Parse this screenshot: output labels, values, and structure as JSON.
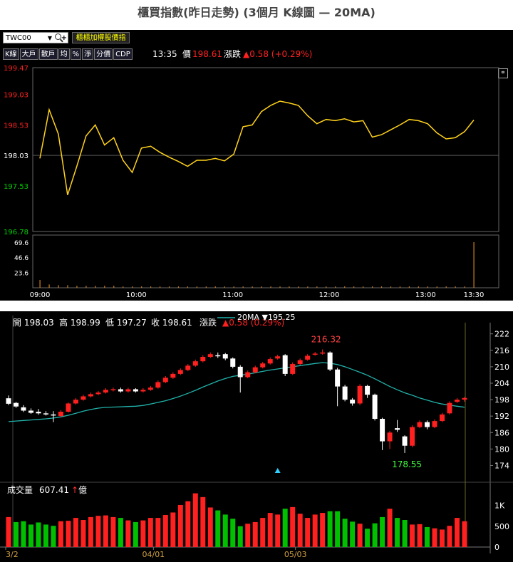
{
  "title": "櫃買指數(昨日走勢) (3個月 K線圖  — 20MA)",
  "toolbar": {
    "symbol": "TWC00",
    "otc_button": "櫃櫃加權股價指",
    "tools": [
      "K線",
      "大戶",
      "散戶",
      "均",
      "%",
      "淨",
      "分價",
      "CDP"
    ]
  },
  "quote": {
    "time": "13:35",
    "price_label": "價",
    "price": "198.61",
    "change_label": "漲跌",
    "change": "▲0.58 (+0.29%)"
  },
  "icons": {
    "link": "link-icon",
    "search": "search-icon",
    "add": "plus-icon"
  },
  "colors": {
    "up": "#ff2020",
    "down": "#00c000",
    "flat": "#ffffff",
    "line": "#ffd21a",
    "ma": "#20b2aa"
  },
  "chart_data": [
    {
      "type": "line",
      "yticks": [
        "199.47",
        "199.03",
        "198.53",
        "198.03",
        "197.53",
        "196.78"
      ],
      "ylim": [
        196.78,
        199.47
      ],
      "volume_ticks": [
        "69.6",
        "46.6",
        "23.6"
      ],
      "xticks": [
        "09:00",
        "10:00",
        "11:00",
        "12:00",
        "13:00",
        "13:30"
      ],
      "x": [
        "09:00",
        "09:05",
        "09:10",
        "09:15",
        "09:20",
        "09:25",
        "09:30",
        "09:35",
        "09:40",
        "09:45",
        "09:50",
        "09:55",
        "10:00",
        "10:05",
        "10:10",
        "10:15",
        "10:20",
        "10:25",
        "10:30",
        "10:35",
        "10:40",
        "10:45",
        "10:50",
        "10:55",
        "11:00",
        "11:05",
        "11:10",
        "11:15",
        "11:20",
        "11:25",
        "11:30",
        "11:35",
        "11:40",
        "11:45",
        "11:50",
        "11:55",
        "12:00",
        "12:05",
        "12:10",
        "12:15",
        "12:20",
        "12:25",
        "12:30",
        "12:35",
        "12:40",
        "12:45",
        "12:50",
        "12:55",
        "13:00",
        "13:05",
        "13:10",
        "13:15",
        "13:20",
        "13:25",
        "13:30"
      ],
      "values": [
        197.98,
        198.78,
        198.38,
        197.38,
        197.85,
        198.35,
        198.53,
        198.2,
        198.32,
        197.95,
        197.75,
        198.15,
        198.18,
        198.08,
        198.0,
        197.93,
        197.85,
        197.95,
        197.95,
        197.98,
        197.94,
        198.05,
        198.5,
        198.53,
        198.75,
        198.85,
        198.92,
        198.89,
        198.85,
        198.68,
        198.55,
        198.62,
        198.6,
        198.63,
        198.58,
        198.6,
        198.33,
        198.37,
        198.45,
        198.53,
        198.62,
        198.6,
        198.55,
        198.4,
        198.3,
        198.32,
        198.42,
        198.61
      ],
      "volume": [
        12,
        5,
        4,
        4,
        3,
        3,
        3,
        3,
        3,
        2,
        2,
        2,
        2,
        2,
        2,
        2,
        2,
        2,
        2,
        2,
        2,
        2,
        2,
        2,
        2,
        2,
        2,
        2,
        2,
        2,
        2,
        2,
        2,
        2,
        2,
        2,
        2,
        2,
        2,
        2,
        2,
        2,
        2,
        2,
        2,
        2,
        2,
        69.6
      ]
    },
    {
      "type": "candlestick",
      "ohlc_label": {
        "open": "開 198.03",
        "high": "高 198.99",
        "low": "低 197.27",
        "close": "收 198.61",
        "change_label": "漲跌",
        "change": "▲0.58 (0.29%)"
      },
      "ma_label": "20MA ▼195.25",
      "yticks": [
        "222",
        "216",
        "210",
        "204",
        "198",
        "192",
        "186",
        "180",
        "174"
      ],
      "ylim": [
        171,
        224
      ],
      "volume_label": {
        "text": "成交量",
        "value": "607.41",
        "unit": "億"
      },
      "volume_ticks": [
        "1K",
        "500",
        "0"
      ],
      "vlim": [
        0,
        1300
      ],
      "xticks": [
        "3/2",
        "04/01",
        "05/03"
      ],
      "annotations": [
        "216.32",
        "178.55"
      ],
      "candles": [
        [
          198.5,
          196.5,
          199.5,
          196.0
        ],
        [
          196.8,
          195.5,
          197.2,
          195.0
        ],
        [
          195.2,
          194.0,
          196.0,
          193.5
        ],
        [
          194.0,
          193.2,
          194.8,
          192.8
        ],
        [
          193.6,
          193.0,
          194.6,
          192.5
        ],
        [
          193.0,
          192.6,
          193.8,
          192.2
        ],
        [
          192.6,
          192.2,
          193.8,
          189.8
        ],
        [
          192.0,
          193.6,
          194.2,
          191.6
        ],
        [
          193.6,
          196.6,
          197.0,
          193.3
        ],
        [
          196.6,
          198.0,
          198.6,
          196.2
        ],
        [
          198.0,
          199.2,
          199.8,
          197.6
        ],
        [
          199.2,
          200.0,
          200.6,
          198.8
        ],
        [
          200.0,
          200.6,
          201.2,
          199.6
        ],
        [
          200.6,
          201.6,
          202.2,
          200.2
        ],
        [
          201.6,
          201.8,
          202.4,
          201.0
        ],
        [
          201.8,
          201.0,
          202.4,
          200.6
        ],
        [
          201.0,
          201.8,
          202.4,
          200.6
        ],
        [
          201.8,
          201.0,
          202.2,
          200.6
        ],
        [
          201.0,
          201.6,
          202.2,
          200.6
        ],
        [
          201.6,
          202.4,
          203.0,
          201.2
        ],
        [
          202.4,
          204.4,
          205.0,
          202.0
        ],
        [
          204.4,
          206.0,
          206.6,
          204.0
        ],
        [
          206.0,
          207.4,
          208.0,
          205.6
        ],
        [
          207.4,
          208.8,
          209.4,
          207.0
        ],
        [
          208.8,
          210.4,
          211.0,
          208.4
        ],
        [
          210.4,
          212.0,
          212.6,
          210.0
        ],
        [
          212.0,
          213.6,
          214.2,
          211.6
        ],
        [
          213.6,
          214.6,
          215.2,
          213.2
        ],
        [
          214.2,
          214.2,
          215.2,
          213.2
        ],
        [
          214.6,
          213.0,
          215.0,
          212.4
        ],
        [
          213.0,
          210.0,
          213.4,
          209.4
        ],
        [
          210.0,
          206.2,
          210.6,
          200.6
        ],
        [
          206.2,
          208.0,
          208.6,
          205.8
        ],
        [
          208.0,
          209.8,
          210.4,
          207.6
        ],
        [
          209.8,
          211.2,
          211.8,
          209.4
        ],
        [
          211.2,
          212.8,
          213.4,
          210.8
        ],
        [
          213.0,
          213.8,
          214.4,
          212.6
        ],
        [
          214.2,
          207.4,
          214.6,
          206.6
        ],
        [
          207.4,
          211.0,
          211.6,
          207.0
        ],
        [
          211.0,
          212.4,
          213.0,
          210.6
        ],
        [
          212.6,
          214.0,
          214.6,
          212.2
        ],
        [
          214.4,
          214.8,
          215.4,
          214.0
        ],
        [
          214.8,
          215.2,
          216.32,
          214.4
        ],
        [
          215.2,
          209.0,
          215.6,
          208.4
        ],
        [
          209.0,
          202.8,
          209.6,
          195.6
        ],
        [
          202.8,
          198.0,
          203.4,
          197.4
        ],
        [
          198.0,
          196.6,
          198.6,
          195.8
        ],
        [
          196.6,
          203.0,
          203.6,
          196.0
        ],
        [
          203.0,
          199.8,
          203.4,
          198.6
        ],
        [
          199.8,
          191.0,
          200.2,
          190.4
        ],
        [
          191.0,
          182.8,
          191.4,
          179.6
        ],
        [
          182.8,
          186.0,
          186.6,
          180.0
        ],
        [
          187.6,
          187.0,
          190.6,
          186.2
        ],
        [
          184.6,
          181.2,
          185.0,
          178.55
        ],
        [
          181.2,
          188.0,
          188.6,
          180.6
        ],
        [
          188.0,
          189.8,
          190.4,
          187.6
        ],
        [
          189.8,
          188.0,
          190.4,
          187.2
        ],
        [
          188.0,
          190.2,
          190.8,
          187.6
        ],
        [
          190.2,
          192.6,
          193.2,
          189.8
        ],
        [
          193.0,
          196.8,
          197.4,
          192.6
        ],
        [
          197.2,
          198.0,
          198.6,
          196.8
        ],
        [
          198.0,
          198.61,
          198.99,
          197.27
        ]
      ],
      "ma20": [
        190.0,
        190.2,
        190.4,
        190.6,
        190.8,
        191.0,
        191.3,
        191.7,
        192.3,
        193.0,
        193.8,
        194.4,
        194.9,
        195.2,
        195.3,
        195.4,
        195.5,
        195.6,
        195.9,
        196.4,
        197.0,
        197.6,
        198.4,
        199.3,
        200.3,
        201.4,
        202.6,
        203.7,
        204.8,
        205.7,
        206.5,
        206.9,
        207.3,
        207.8,
        208.3,
        208.8,
        209.2,
        209.6,
        210.0,
        210.4,
        210.8,
        211.2,
        211.5,
        211.3,
        210.8,
        210.0,
        209.0,
        208.0,
        206.9,
        205.6,
        204.2,
        202.8,
        201.6,
        200.5,
        199.6,
        198.6,
        197.8,
        197.0,
        196.4,
        196.0,
        195.6,
        195.25
      ],
      "volumes": [
        720,
        600,
        620,
        540,
        590,
        540,
        510,
        620,
        630,
        700,
        650,
        720,
        750,
        760,
        720,
        700,
        640,
        600,
        640,
        700,
        700,
        770,
        830,
        1010,
        1100,
        1290,
        1200,
        950,
        880,
        780,
        680,
        500,
        560,
        600,
        700,
        820,
        780,
        920,
        960,
        800,
        700,
        780,
        820,
        860,
        860,
        680,
        610,
        560,
        440,
        570,
        720,
        920,
        700,
        650,
        540,
        550,
        480,
        450,
        420,
        510,
        700,
        620
      ],
      "volume_up": [
        true,
        false,
        false,
        false,
        false,
        false,
        false,
        true,
        true,
        true,
        true,
        true,
        true,
        true,
        true,
        false,
        true,
        false,
        true,
        true,
        true,
        true,
        true,
        true,
        true,
        true,
        true,
        true,
        false,
        false,
        false,
        false,
        true,
        true,
        true,
        true,
        true,
        false,
        true,
        true,
        true,
        true,
        true,
        false,
        false,
        false,
        false,
        true,
        false,
        false,
        false,
        true,
        false,
        false,
        true,
        true,
        false,
        true,
        true,
        true,
        true,
        true
      ]
    }
  ]
}
